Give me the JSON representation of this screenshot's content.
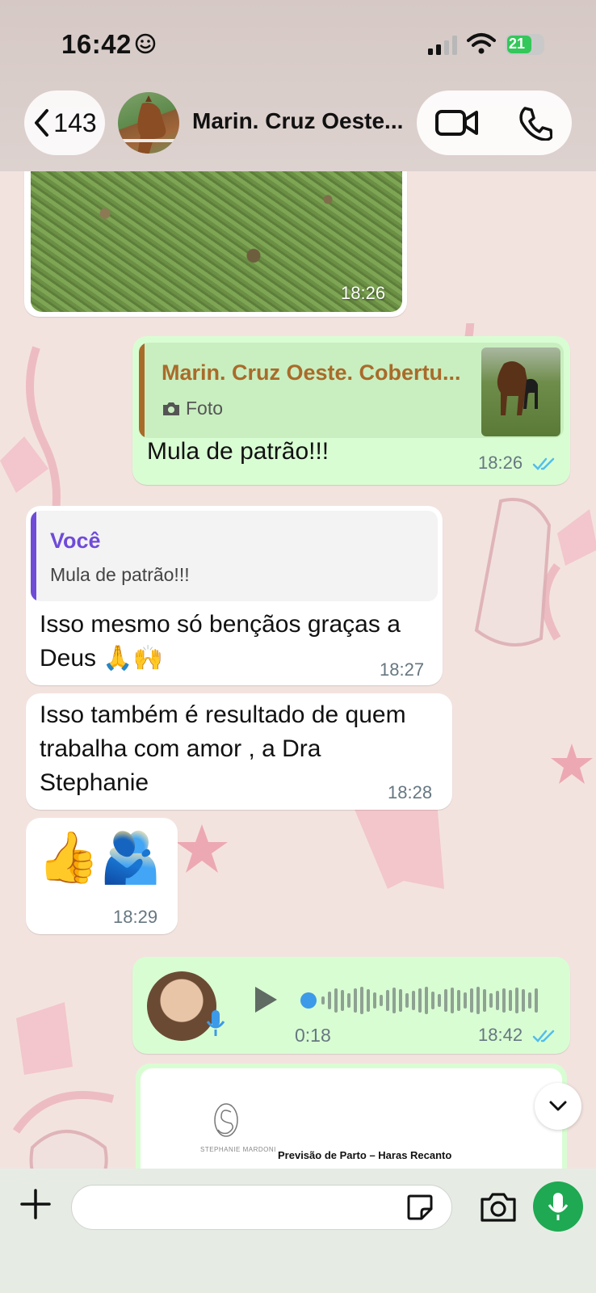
{
  "status_bar": {
    "time": "16:42",
    "battery": "21"
  },
  "header": {
    "back_count": "143",
    "contact_name": "Marin. Cruz Oeste..."
  },
  "messages": [
    {
      "id": "photo-in",
      "direction": "in",
      "time": "18:26"
    },
    {
      "id": "reply-out",
      "direction": "out",
      "quote": {
        "author": "Marin. Cruz Oeste. Cobertu...",
        "type_label": "Foto"
      },
      "text": "Mula de patrão!!!",
      "time": "18:26",
      "status": "read"
    },
    {
      "id": "reply-in",
      "direction": "in",
      "quote": {
        "author": "Você",
        "text": "Mula de patrão!!!"
      },
      "text_line1": "Isso mesmo só bençãos graças a",
      "text_line2": "Deus 🙏🙌",
      "time": "18:27"
    },
    {
      "id": "text-in",
      "direction": "in",
      "lines": [
        "Isso também é resultado de quem",
        "trabalha com amor , a Dra",
        "Stephanie"
      ],
      "time": "18:28"
    },
    {
      "id": "emoji-in",
      "direction": "in",
      "text": "👍🫂",
      "time": "18:29"
    },
    {
      "id": "voice-out",
      "direction": "out",
      "duration": "0:18",
      "time": "18:42",
      "status": "read"
    },
    {
      "id": "doc-out",
      "direction": "out",
      "doc_logo_text": "STEPHANIE MARDONI",
      "doc_title": "Previsão de Parto – Haras Recanto"
    }
  ],
  "input": {
    "value": "",
    "placeholder": ""
  },
  "colors": {
    "outgoing_bubble": "#d9fdd3",
    "incoming_bubble": "#ffffff",
    "read_tick": "#53bdeb",
    "quote_self": "#6f4bd8",
    "quote_other": "#a96b2a",
    "accent_green": "#1ea952"
  },
  "icons": [
    "back-chevron-icon",
    "video-call-icon",
    "voice-call-icon",
    "camera-small-icon",
    "double-check-icon",
    "play-icon",
    "mic-icon",
    "chevron-down-icon",
    "plus-icon",
    "sticker-icon",
    "camera-icon"
  ]
}
